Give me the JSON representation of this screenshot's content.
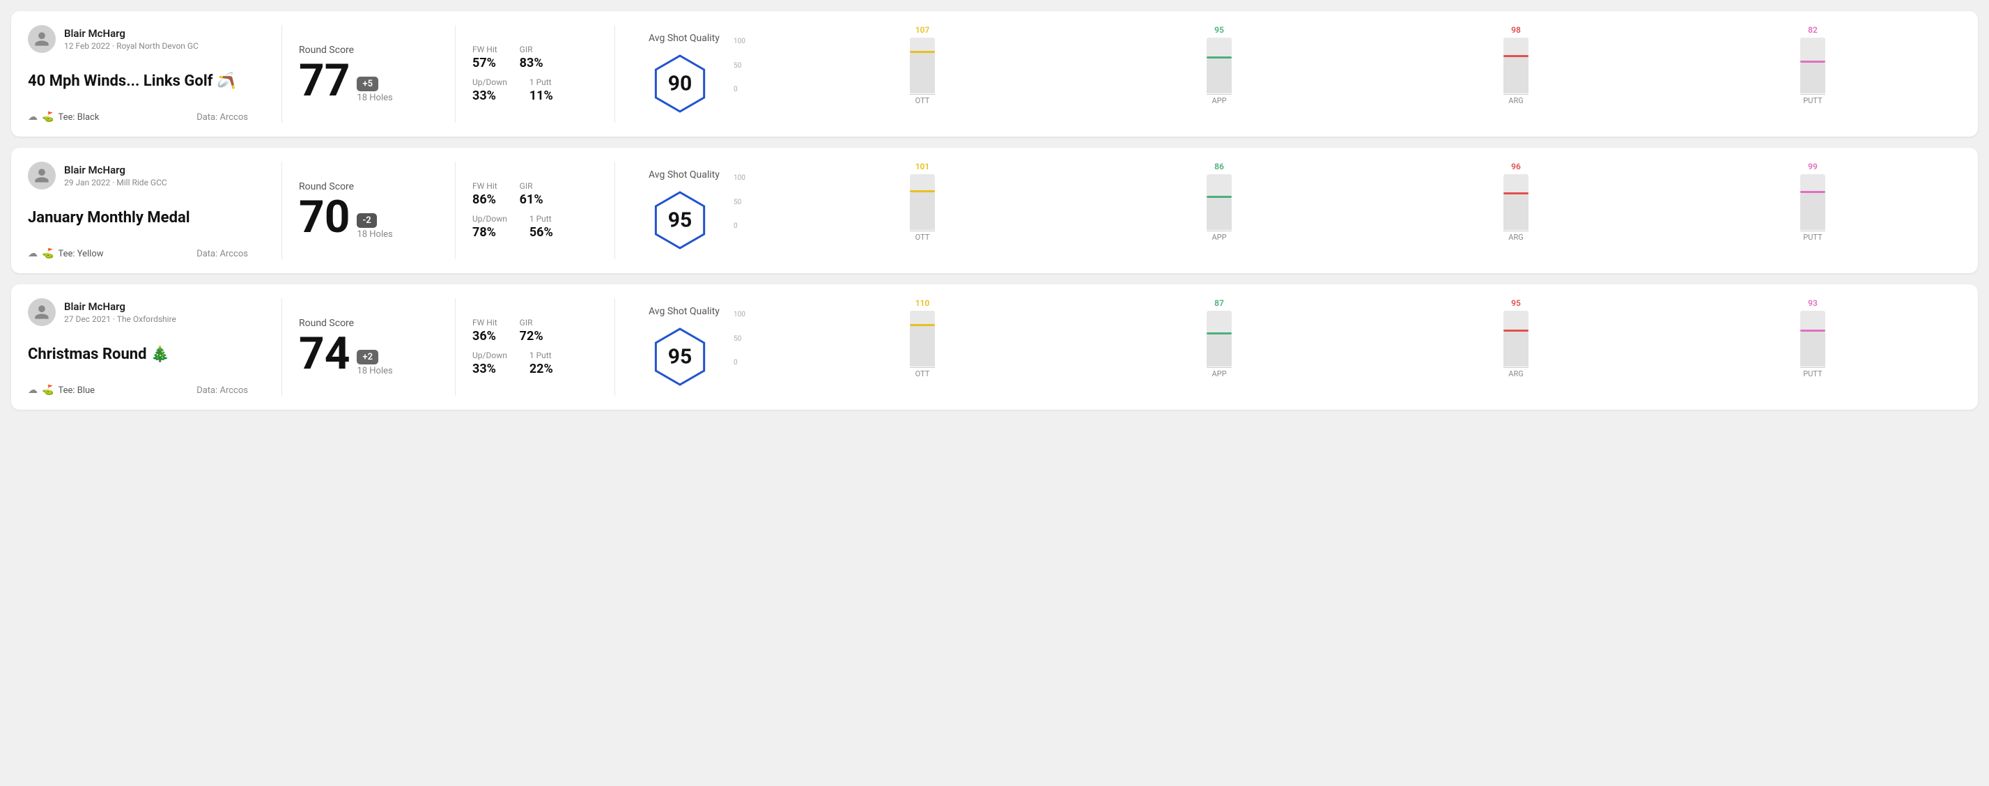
{
  "rounds": [
    {
      "id": "round1",
      "user": {
        "name": "Blair McHarg",
        "date": "12 Feb 2022 · Royal North Devon GC"
      },
      "title": "40 Mph Winds... Links Golf 🪃",
      "tee": "Black",
      "data_source": "Data: Arccos",
      "score": {
        "value": "77",
        "diff": "+5",
        "diff_type": "plus",
        "holes": "18 Holes"
      },
      "stats": {
        "fw_hit": "57%",
        "gir": "83%",
        "up_down": "33%",
        "one_putt": "11%"
      },
      "quality": {
        "label": "Avg Shot Quality",
        "score": "90"
      },
      "chart": {
        "bars": [
          {
            "label": "OTT",
            "value": 107,
            "color": "#e8c020",
            "fill_pct": 72
          },
          {
            "label": "APP",
            "value": 95,
            "color": "#4caf7d",
            "fill_pct": 63
          },
          {
            "label": "ARG",
            "value": 98,
            "color": "#e05050",
            "fill_pct": 65
          },
          {
            "label": "PUTT",
            "value": 82,
            "color": "#e070c0",
            "fill_pct": 55
          }
        ]
      }
    },
    {
      "id": "round2",
      "user": {
        "name": "Blair McHarg",
        "date": "29 Jan 2022 · Mill Ride GCC"
      },
      "title": "January Monthly Medal",
      "tee": "Yellow",
      "data_source": "Data: Arccos",
      "score": {
        "value": "70",
        "diff": "-2",
        "diff_type": "minus",
        "holes": "18 Holes"
      },
      "stats": {
        "fw_hit": "86%",
        "gir": "61%",
        "up_down": "78%",
        "one_putt": "56%"
      },
      "quality": {
        "label": "Avg Shot Quality",
        "score": "95"
      },
      "chart": {
        "bars": [
          {
            "label": "OTT",
            "value": 101,
            "color": "#e8c020",
            "fill_pct": 68
          },
          {
            "label": "APP",
            "value": 86,
            "color": "#4caf7d",
            "fill_pct": 57
          },
          {
            "label": "ARG",
            "value": 96,
            "color": "#e05050",
            "fill_pct": 64
          },
          {
            "label": "PUTT",
            "value": 99,
            "color": "#e070c0",
            "fill_pct": 66
          }
        ]
      }
    },
    {
      "id": "round3",
      "user": {
        "name": "Blair McHarg",
        "date": "27 Dec 2021 · The Oxfordshire"
      },
      "title": "Christmas Round 🎄",
      "tee": "Blue",
      "data_source": "Data: Arccos",
      "score": {
        "value": "74",
        "diff": "+2",
        "diff_type": "plus",
        "holes": "18 Holes"
      },
      "stats": {
        "fw_hit": "36%",
        "gir": "72%",
        "up_down": "33%",
        "one_putt": "22%"
      },
      "quality": {
        "label": "Avg Shot Quality",
        "score": "95"
      },
      "chart": {
        "bars": [
          {
            "label": "OTT",
            "value": 110,
            "color": "#e8c020",
            "fill_pct": 73
          },
          {
            "label": "APP",
            "value": 87,
            "color": "#4caf7d",
            "fill_pct": 58
          },
          {
            "label": "ARG",
            "value": 95,
            "color": "#e05050",
            "fill_pct": 63
          },
          {
            "label": "PUTT",
            "value": 93,
            "color": "#e070c0",
            "fill_pct": 62
          }
        ]
      }
    }
  ],
  "labels": {
    "round_score": "Round Score",
    "avg_shot_quality": "Avg Shot Quality",
    "fw_hit": "FW Hit",
    "gir": "GIR",
    "up_down": "Up/Down",
    "one_putt": "1 Putt",
    "tee_prefix": "Tee:",
    "y_axis": [
      "100",
      "50",
      "0"
    ]
  }
}
